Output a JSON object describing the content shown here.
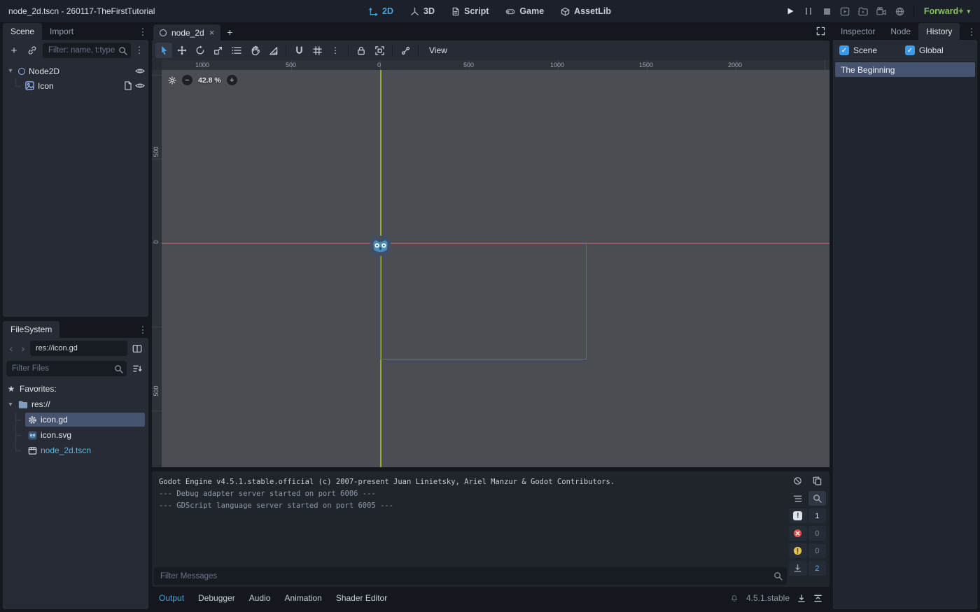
{
  "colors": {
    "accent_blue": "#4ba1e0",
    "renderer_green": "#86c25a",
    "error_red": "#e0504f",
    "warning_yellow": "#e7c251",
    "axis_green": "#a8ba2a",
    "axis_red": "#cd6e6e",
    "view_rect_purple": "#6868d6",
    "selection_bg": "#46536f"
  },
  "glyphs": {
    "kebab": "⋮",
    "caret_down": "▾",
    "star": "★",
    "plus": "+",
    "minus": "−",
    "close": "×",
    "back": "‹",
    "forward": "›",
    "check": "✓",
    "exclaim": "!"
  },
  "titlebar": {
    "title": "node_2d.tscn - 260117-TheFirstTutorial",
    "workspaces": [
      {
        "label": "2D"
      },
      {
        "label": "3D"
      },
      {
        "label": "Script"
      },
      {
        "label": "Game"
      },
      {
        "label": "AssetLib"
      }
    ],
    "renderer": "Forward+"
  },
  "scene_dock": {
    "tabs": [
      {
        "label": "Scene"
      },
      {
        "label": "Import"
      }
    ],
    "filter_placeholder": "Filter: name, t:type,",
    "nodes": [
      {
        "label": "Node2D"
      },
      {
        "label": "Icon"
      }
    ]
  },
  "filesystem_dock": {
    "tab_label": "FileSystem",
    "path_value": "res://icon.gd",
    "filter_placeholder": "Filter Files",
    "favorites_label": "Favorites:",
    "root_label": "res://",
    "files": [
      {
        "label": "icon.gd"
      },
      {
        "label": "icon.svg"
      },
      {
        "label": "node_2d.tscn"
      }
    ]
  },
  "canvas": {
    "scene_tab_label": "node_2d",
    "zoom_value": "42.8 %",
    "view_menu_label": "View",
    "top_ruler_labels": [
      "1000",
      "500",
      "0",
      "500",
      "1000",
      "1500",
      "2000"
    ],
    "left_ruler_labels": [
      "500",
      "0",
      "500"
    ]
  },
  "output_panel": {
    "lines": [
      "Godot Engine v4.5.1.stable.official (c) 2007-present Juan Linietsky, Ariel Manzur & Godot Contributors.",
      "--- Debug adapter server started on port 6006 ---",
      "--- GDScript language server started on port 6005 ---"
    ],
    "filter_placeholder": "Filter Messages",
    "counters": [
      {
        "name": "important",
        "count": "1"
      },
      {
        "name": "errors",
        "count": "0"
      },
      {
        "name": "warnings",
        "count": "0"
      },
      {
        "name": "messages",
        "count": "2"
      }
    ],
    "tabs": [
      {
        "label": "Output"
      },
      {
        "label": "Debugger"
      },
      {
        "label": "Audio"
      },
      {
        "label": "Animation"
      },
      {
        "label": "Shader Editor"
      }
    ],
    "version": "4.5.1.stable"
  },
  "history_dock": {
    "tabs": [
      {
        "label": "Inspector"
      },
      {
        "label": "Node"
      },
      {
        "label": "History"
      }
    ],
    "filters": [
      {
        "label": "Scene"
      },
      {
        "label": "Global"
      }
    ],
    "items": [
      {
        "label": "The Beginning"
      }
    ]
  }
}
